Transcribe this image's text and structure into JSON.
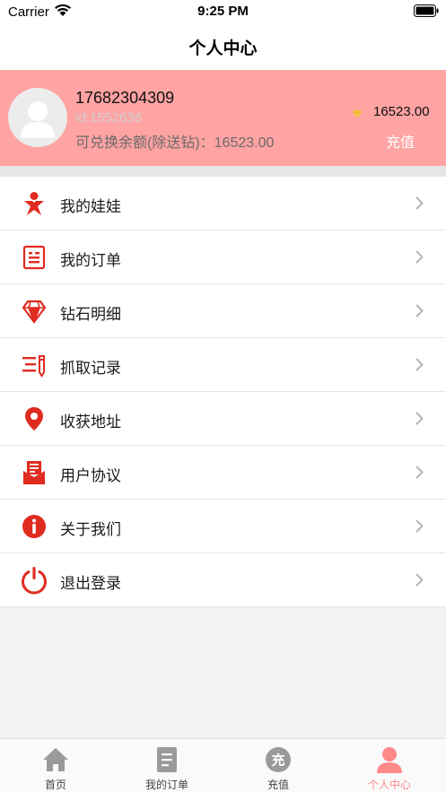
{
  "status_bar": {
    "carrier": "Carrier",
    "time": "9:25 PM"
  },
  "nav": {
    "title": "个人中心"
  },
  "profile": {
    "phone": "17682304309",
    "user_id": "id:1552636",
    "balance": "可兑换余额(除送钻)：16523.00",
    "diamonds": "16523.00",
    "recharge_label": "充值"
  },
  "menu": {
    "items": [
      {
        "label": "我的娃娃",
        "icon": "doll-icon"
      },
      {
        "label": "我的订单",
        "icon": "order-icon"
      },
      {
        "label": "钻石明细",
        "icon": "diamond-icon"
      },
      {
        "label": "抓取记录",
        "icon": "record-icon"
      },
      {
        "label": "收获地址",
        "icon": "location-icon"
      },
      {
        "label": "用户协议",
        "icon": "agreement-icon"
      },
      {
        "label": "关于我们",
        "icon": "info-icon"
      },
      {
        "label": "退出登录",
        "icon": "power-icon"
      }
    ]
  },
  "tabs": [
    {
      "label": "首页",
      "icon": "home-icon"
    },
    {
      "label": "我的订单",
      "icon": "orders-tab-icon"
    },
    {
      "label": "充值",
      "icon": "recharge-tab-icon",
      "glyph": "充"
    },
    {
      "label": "个人中心",
      "icon": "profile-tab-icon",
      "active": true
    }
  ],
  "colors": {
    "accent_red": "#e02b20",
    "profile_bg": "#ffa3a3",
    "tab_active": "#ff8a8a",
    "tab_inactive": "#9a9a9a"
  }
}
